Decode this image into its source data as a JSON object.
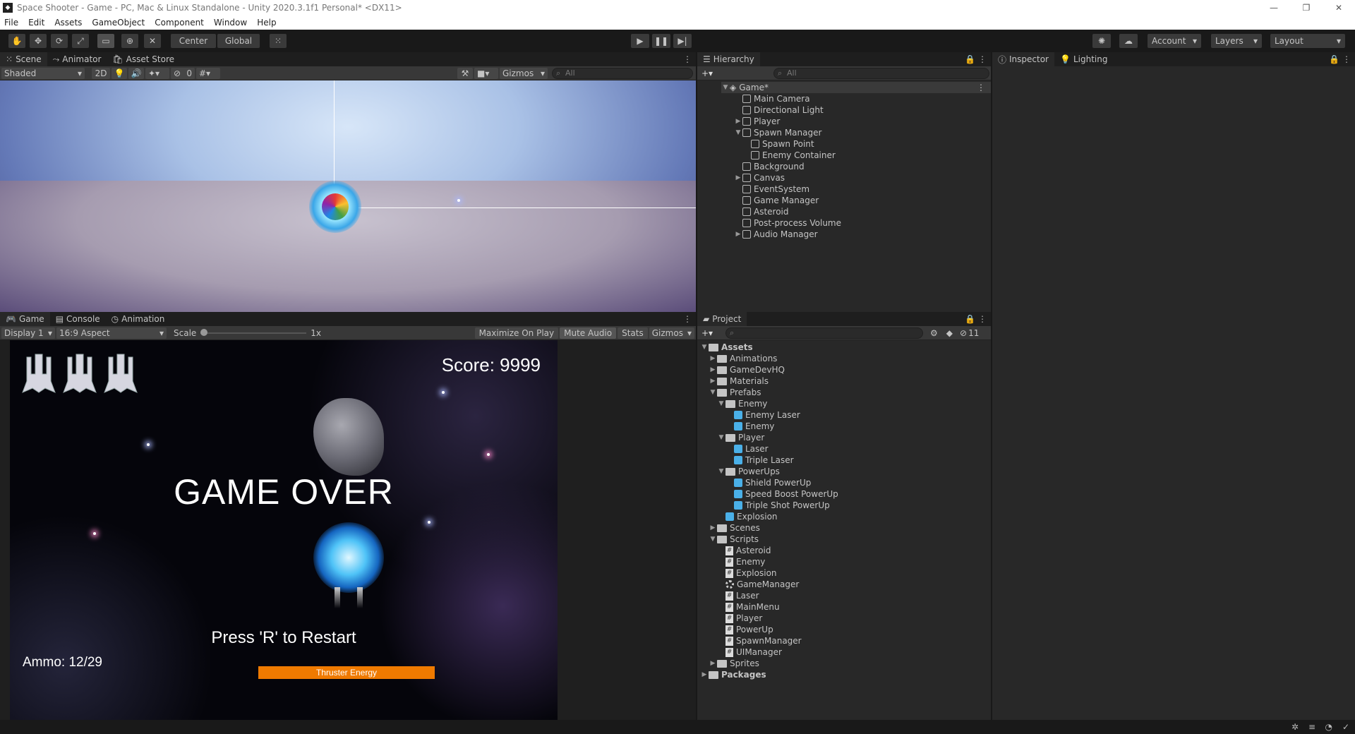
{
  "window": {
    "title": "Space Shooter - Game - PC, Mac & Linux Standalone - Unity 2020.3.1f1 Personal* <DX11>",
    "controls": [
      "—",
      "❐",
      "✕"
    ]
  },
  "menu": [
    "File",
    "Edit",
    "Assets",
    "GameObject",
    "Component",
    "Window",
    "Help"
  ],
  "toolbar": {
    "pivot_label": "Center",
    "space_label": "Global",
    "account_label": "Account",
    "layers_label": "Layers",
    "layout_label": "Layout"
  },
  "scene": {
    "tabs": [
      "Scene",
      "Animator",
      "Asset Store"
    ],
    "shading": "Shaded",
    "mode_2d": "2D",
    "hidden_count": "0",
    "gizmos_label": "Gizmos",
    "search_placeholder": "All"
  },
  "game": {
    "tabs": [
      "Game",
      "Console",
      "Animation"
    ],
    "display": "Display 1",
    "aspect": "16:9 Aspect",
    "scale_label": "Scale",
    "scale_value": "1x",
    "scale_level": 0,
    "maximize": "Maximize On Play",
    "mute": "Mute Audio",
    "stats": "Stats",
    "gizmos": "Gizmos",
    "score_text": "Score: 9999",
    "game_over": "GAME OVER",
    "restart": "Press 'R' to Restart",
    "ammo": "Ammo: 12/29",
    "thruster": "Thruster Energy",
    "thruster_level": 1.0,
    "lives": 3
  },
  "hierarchy": {
    "title": "Hierarchy",
    "search_placeholder": "All",
    "root": "Game*",
    "items": [
      {
        "label": "Main Camera",
        "depth": 1,
        "arrow": ""
      },
      {
        "label": "Directional Light",
        "depth": 1,
        "arrow": ""
      },
      {
        "label": "Player",
        "depth": 1,
        "arrow": "▶"
      },
      {
        "label": "Spawn Manager",
        "depth": 1,
        "arrow": "▼"
      },
      {
        "label": "Spawn Point",
        "depth": 2,
        "arrow": ""
      },
      {
        "label": "Enemy Container",
        "depth": 2,
        "arrow": ""
      },
      {
        "label": "Background",
        "depth": 1,
        "arrow": ""
      },
      {
        "label": "Canvas",
        "depth": 1,
        "arrow": "▶"
      },
      {
        "label": "EventSystem",
        "depth": 1,
        "arrow": ""
      },
      {
        "label": "Game Manager",
        "depth": 1,
        "arrow": ""
      },
      {
        "label": "Asteroid",
        "depth": 1,
        "arrow": ""
      },
      {
        "label": "Post-process Volume",
        "depth": 1,
        "arrow": ""
      },
      {
        "label": "Audio Manager",
        "depth": 1,
        "arrow": "▶"
      }
    ]
  },
  "inspector": {
    "tabs": [
      "Inspector",
      "Lighting"
    ]
  },
  "project": {
    "title": "Project",
    "hidden_count": "11",
    "items": [
      {
        "label": "Assets",
        "depth": 0,
        "arrow": "▼",
        "icon": "folder"
      },
      {
        "label": "Animations",
        "depth": 1,
        "arrow": "▶",
        "icon": "folder"
      },
      {
        "label": "GameDevHQ",
        "depth": 1,
        "arrow": "▶",
        "icon": "folder"
      },
      {
        "label": "Materials",
        "depth": 1,
        "arrow": "▶",
        "icon": "folder"
      },
      {
        "label": "Prefabs",
        "depth": 1,
        "arrow": "▼",
        "icon": "folder"
      },
      {
        "label": "Enemy",
        "depth": 2,
        "arrow": "▼",
        "icon": "folder"
      },
      {
        "label": "Enemy Laser",
        "depth": 3,
        "arrow": "",
        "icon": "prefab"
      },
      {
        "label": "Enemy",
        "depth": 3,
        "arrow": "",
        "icon": "prefab"
      },
      {
        "label": "Player",
        "depth": 2,
        "arrow": "▼",
        "icon": "folder"
      },
      {
        "label": "Laser",
        "depth": 3,
        "arrow": "",
        "icon": "prefab"
      },
      {
        "label": "Triple Laser",
        "depth": 3,
        "arrow": "",
        "icon": "prefab"
      },
      {
        "label": "PowerUps",
        "depth": 2,
        "arrow": "▼",
        "icon": "folder"
      },
      {
        "label": "Shield PowerUp",
        "depth": 3,
        "arrow": "",
        "icon": "prefab"
      },
      {
        "label": "Speed Boost PowerUp",
        "depth": 3,
        "arrow": "",
        "icon": "prefab"
      },
      {
        "label": "Triple Shot PowerUp",
        "depth": 3,
        "arrow": "",
        "icon": "prefab"
      },
      {
        "label": "Explosion",
        "depth": 2,
        "arrow": "",
        "icon": "prefab"
      },
      {
        "label": "Scenes",
        "depth": 1,
        "arrow": "▶",
        "icon": "folder"
      },
      {
        "label": "Scripts",
        "depth": 1,
        "arrow": "▼",
        "icon": "folder"
      },
      {
        "label": "Asteroid",
        "depth": 2,
        "arrow": "",
        "icon": "script"
      },
      {
        "label": "Enemy",
        "depth": 2,
        "arrow": "",
        "icon": "script"
      },
      {
        "label": "Explosion",
        "depth": 2,
        "arrow": "",
        "icon": "script"
      },
      {
        "label": "GameManager",
        "depth": 2,
        "arrow": "",
        "icon": "gear"
      },
      {
        "label": "Laser",
        "depth": 2,
        "arrow": "",
        "icon": "script"
      },
      {
        "label": "MainMenu",
        "depth": 2,
        "arrow": "",
        "icon": "script"
      },
      {
        "label": "Player",
        "depth": 2,
        "arrow": "",
        "icon": "script"
      },
      {
        "label": "PowerUp",
        "depth": 2,
        "arrow": "",
        "icon": "script"
      },
      {
        "label": "SpawnManager",
        "depth": 2,
        "arrow": "",
        "icon": "script"
      },
      {
        "label": "UIManager",
        "depth": 2,
        "arrow": "",
        "icon": "script"
      },
      {
        "label": "Sprites",
        "depth": 1,
        "arrow": "▶",
        "icon": "folder"
      },
      {
        "label": "Packages",
        "depth": 0,
        "arrow": "▶",
        "icon": "folder"
      }
    ]
  }
}
